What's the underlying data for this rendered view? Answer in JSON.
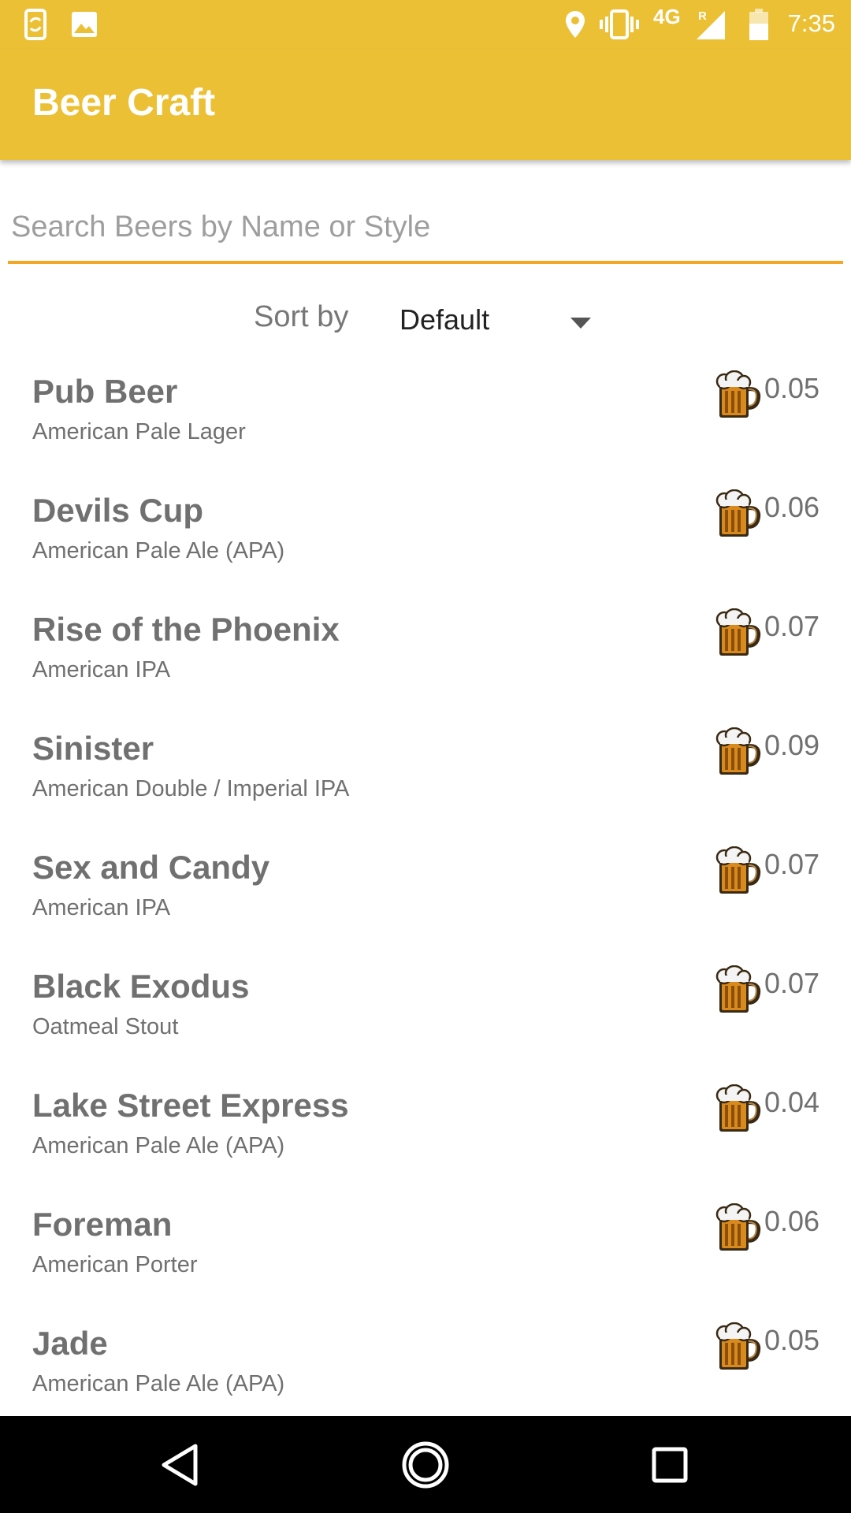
{
  "status_bar": {
    "time": "7:35",
    "network": "4G",
    "roaming": "R",
    "icons": [
      "phone-sync-icon",
      "image-icon",
      "location-icon",
      "vibrate-icon",
      "signal-icon",
      "battery-icon"
    ]
  },
  "app_bar": {
    "title": "Beer Craft",
    "color": "#ECC035"
  },
  "search": {
    "placeholder": "Search Beers by Name or Style",
    "value": "",
    "underline_color": "#F5A623"
  },
  "sort": {
    "label": "Sort by",
    "selected": "Default"
  },
  "beers": [
    {
      "name": "Pub Beer",
      "style": "American Pale Lager",
      "abv": "0.05"
    },
    {
      "name": "Devils Cup",
      "style": "American Pale Ale (APA)",
      "abv": "0.06"
    },
    {
      "name": "Rise of the Phoenix",
      "style": "American IPA",
      "abv": "0.07"
    },
    {
      "name": "Sinister",
      "style": "American Double / Imperial IPA",
      "abv": "0.09"
    },
    {
      "name": "Sex and Candy",
      "style": "American IPA",
      "abv": "0.07"
    },
    {
      "name": "Black Exodus",
      "style": "Oatmeal Stout",
      "abv": "0.07"
    },
    {
      "name": "Lake Street Express",
      "style": "American Pale Ale (APA)",
      "abv": "0.04"
    },
    {
      "name": "Foreman",
      "style": "American Porter",
      "abv": "0.06"
    },
    {
      "name": "Jade",
      "style": "American Pale Ale (APA)",
      "abv": "0.05"
    }
  ],
  "nav_bar": {
    "buttons": [
      "back-icon",
      "home-icon",
      "recents-icon"
    ]
  }
}
